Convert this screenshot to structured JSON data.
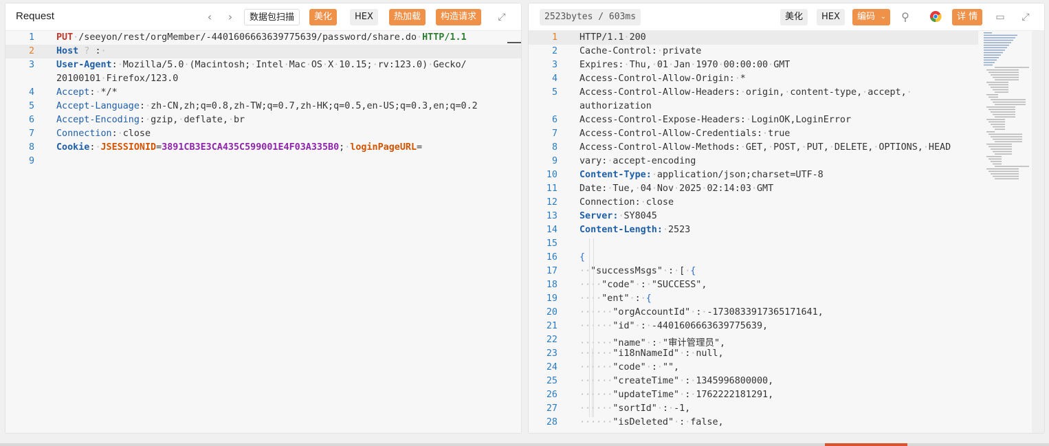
{
  "request": {
    "title": "Request",
    "buttons": {
      "scan": "数据包扫描",
      "beautify": "美化",
      "hex": "HEX",
      "hotload": "热加载",
      "construct": "构造请求"
    },
    "lines": [
      {
        "n": "1",
        "parts": [
          [
            "m",
            "PUT"
          ],
          [
            "d",
            "·"
          ],
          [
            "t",
            "/seeyon/rest/orgMember/-4401606663639775639/password/share.do"
          ],
          [
            "d",
            "·"
          ],
          [
            "v",
            "HTTP/1.1"
          ]
        ]
      },
      {
        "n": "2",
        "parts": [
          [
            "kb",
            "Host"
          ],
          [
            "d",
            " ? "
          ],
          [
            "t",
            ":"
          ],
          [
            "d",
            "·"
          ]
        ]
      },
      {
        "n": "3",
        "parts": [
          [
            "kb",
            "User-Agent"
          ],
          [
            "t",
            ":"
          ],
          [
            "d",
            "·"
          ],
          [
            "t",
            "Mozilla/5.0"
          ],
          [
            "d",
            "·"
          ],
          [
            "t",
            "(Macintosh;"
          ],
          [
            "d",
            "·"
          ],
          [
            "t",
            "Intel"
          ],
          [
            "d",
            "·"
          ],
          [
            "t",
            "Mac"
          ],
          [
            "d",
            "·"
          ],
          [
            "t",
            "OS"
          ],
          [
            "d",
            "·"
          ],
          [
            "t",
            "X"
          ],
          [
            "d",
            "·"
          ],
          [
            "t",
            "10.15;"
          ],
          [
            "d",
            "·"
          ],
          [
            "t",
            "rv:123.0)"
          ],
          [
            "d",
            "·"
          ],
          [
            "t",
            "Gecko/"
          ]
        ]
      },
      {
        "n": "",
        "parts": [
          [
            "t",
            "20100101"
          ],
          [
            "d",
            "·"
          ],
          [
            "t",
            "Firefox/123.0"
          ]
        ]
      },
      {
        "n": "4",
        "parts": [
          [
            "k",
            "Accept"
          ],
          [
            "t",
            ":"
          ],
          [
            "d",
            "·"
          ],
          [
            "t",
            "*/*"
          ]
        ]
      },
      {
        "n": "5",
        "parts": [
          [
            "k",
            "Accept-Language"
          ],
          [
            "t",
            ":"
          ],
          [
            "d",
            "·"
          ],
          [
            "t",
            "zh-CN,zh;q=0.8,zh-TW;q=0.7,zh-HK;q=0.5,en-US;q=0.3,en;q=0.2"
          ]
        ]
      },
      {
        "n": "6",
        "parts": [
          [
            "k",
            "Accept-Encoding"
          ],
          [
            "t",
            ":"
          ],
          [
            "d",
            "·"
          ],
          [
            "t",
            "gzip,"
          ],
          [
            "d",
            "·"
          ],
          [
            "t",
            "deflate,"
          ],
          [
            "d",
            "·"
          ],
          [
            "t",
            "br"
          ]
        ]
      },
      {
        "n": "7",
        "parts": [
          [
            "k",
            "Connection"
          ],
          [
            "t",
            ":"
          ],
          [
            "d",
            "·"
          ],
          [
            "t",
            "close"
          ]
        ]
      },
      {
        "n": "8",
        "parts": [
          [
            "kb",
            "Cookie"
          ],
          [
            "t",
            ":"
          ],
          [
            "d",
            "·"
          ],
          [
            "ck",
            "JSESSIONID"
          ],
          [
            "t",
            "="
          ],
          [
            "cv",
            "3891CB3E3CA435C599001E4F03A335B0"
          ],
          [
            "t",
            ";"
          ],
          [
            "d",
            "·"
          ],
          [
            "ck",
            "loginPageURL"
          ],
          [
            "t",
            "="
          ]
        ]
      },
      {
        "n": "9",
        "parts": []
      }
    ]
  },
  "response": {
    "size": "2523bytes / 603ms",
    "buttons": {
      "beautify": "美化",
      "hex": "HEX",
      "encoding": "编码",
      "details": "详 情"
    },
    "lines": [
      {
        "n": "1",
        "parts": [
          [
            "t",
            "HTTP/1.1"
          ],
          [
            "d",
            "·"
          ],
          [
            "t",
            "200"
          ]
        ]
      },
      {
        "n": "2",
        "parts": [
          [
            "t",
            "Cache-Control:"
          ],
          [
            "d",
            "·"
          ],
          [
            "t",
            "private"
          ]
        ]
      },
      {
        "n": "3",
        "parts": [
          [
            "t",
            "Expires:"
          ],
          [
            "d",
            "·"
          ],
          [
            "t",
            "Thu,"
          ],
          [
            "d",
            "·"
          ],
          [
            "t",
            "01"
          ],
          [
            "d",
            "·"
          ],
          [
            "t",
            "Jan"
          ],
          [
            "d",
            "·"
          ],
          [
            "t",
            "1970"
          ],
          [
            "d",
            "·"
          ],
          [
            "t",
            "00:00:00"
          ],
          [
            "d",
            "·"
          ],
          [
            "t",
            "GMT"
          ]
        ]
      },
      {
        "n": "4",
        "parts": [
          [
            "t",
            "Access-Control-Allow-Origin:"
          ],
          [
            "d",
            "·"
          ],
          [
            "t",
            "*"
          ]
        ]
      },
      {
        "n": "5",
        "parts": [
          [
            "t",
            "Access-Control-Allow-Headers:"
          ],
          [
            "d",
            "·"
          ],
          [
            "t",
            "origin,"
          ],
          [
            "d",
            "·"
          ],
          [
            "t",
            "content-type,"
          ],
          [
            "d",
            "·"
          ],
          [
            "t",
            "accept,"
          ],
          [
            "d",
            "·"
          ]
        ]
      },
      {
        "n": "",
        "parts": [
          [
            "t",
            "authorization"
          ]
        ]
      },
      {
        "n": "6",
        "parts": [
          [
            "t",
            "Access-Control-Expose-Headers:"
          ],
          [
            "d",
            "·"
          ],
          [
            "t",
            "LoginOK,LoginError"
          ]
        ]
      },
      {
        "n": "7",
        "parts": [
          [
            "t",
            "Access-Control-Allow-Credentials:"
          ],
          [
            "d",
            "·"
          ],
          [
            "t",
            "true"
          ]
        ]
      },
      {
        "n": "8",
        "parts": [
          [
            "t",
            "Access-Control-Allow-Methods:"
          ],
          [
            "d",
            "·"
          ],
          [
            "t",
            "GET,"
          ],
          [
            "d",
            "·"
          ],
          [
            "t",
            "POST,"
          ],
          [
            "d",
            "·"
          ],
          [
            "t",
            "PUT,"
          ],
          [
            "d",
            "·"
          ],
          [
            "t",
            "DELETE,"
          ],
          [
            "d",
            "·"
          ],
          [
            "t",
            "OPTIONS,"
          ],
          [
            "d",
            "·"
          ],
          [
            "t",
            "HEAD"
          ]
        ]
      },
      {
        "n": "9",
        "parts": [
          [
            "t",
            "vary:"
          ],
          [
            "d",
            "·"
          ],
          [
            "t",
            "accept-encoding"
          ]
        ]
      },
      {
        "n": "10",
        "parts": [
          [
            "kb",
            "Content-Type:"
          ],
          [
            "d",
            "·"
          ],
          [
            "t",
            "application/json;charset=UTF-8"
          ]
        ]
      },
      {
        "n": "11",
        "parts": [
          [
            "t",
            "Date:"
          ],
          [
            "d",
            "·"
          ],
          [
            "t",
            "Tue,"
          ],
          [
            "d",
            "·"
          ],
          [
            "t",
            "04"
          ],
          [
            "d",
            "·"
          ],
          [
            "t",
            "Nov"
          ],
          [
            "d",
            "·"
          ],
          [
            "t",
            "2025"
          ],
          [
            "d",
            "·"
          ],
          [
            "t",
            "02:14:03"
          ],
          [
            "d",
            "·"
          ],
          [
            "t",
            "GMT"
          ]
        ]
      },
      {
        "n": "12",
        "parts": [
          [
            "t",
            "Connection:"
          ],
          [
            "d",
            "·"
          ],
          [
            "t",
            "close"
          ]
        ]
      },
      {
        "n": "13",
        "parts": [
          [
            "kb",
            "Server:"
          ],
          [
            "d",
            "·"
          ],
          [
            "t",
            "SY8045"
          ]
        ]
      },
      {
        "n": "14",
        "parts": [
          [
            "kb",
            "Content-Length:"
          ],
          [
            "d",
            "·"
          ],
          [
            "t",
            "2523"
          ]
        ]
      },
      {
        "n": "15",
        "parts": []
      },
      {
        "n": "16",
        "parts": [
          [
            "bt",
            "{"
          ]
        ]
      },
      {
        "n": "17",
        "parts": [
          [
            "d",
            "··"
          ],
          [
            "t",
            "\"successMsgs\""
          ],
          [
            "d",
            "·"
          ],
          [
            "t",
            ":"
          ],
          [
            "d",
            "·"
          ],
          [
            "t",
            "["
          ],
          [
            "d",
            "·"
          ],
          [
            "bt",
            "{"
          ]
        ]
      },
      {
        "n": "18",
        "parts": [
          [
            "d",
            "····"
          ],
          [
            "t",
            "\"code\""
          ],
          [
            "d",
            "·"
          ],
          [
            "t",
            ":"
          ],
          [
            "d",
            "·"
          ],
          [
            "t",
            "\"SUCCESS\","
          ]
        ]
      },
      {
        "n": "19",
        "parts": [
          [
            "d",
            "····"
          ],
          [
            "t",
            "\"ent\""
          ],
          [
            "d",
            "·"
          ],
          [
            "t",
            ":"
          ],
          [
            "d",
            "·"
          ],
          [
            "bt",
            "{"
          ]
        ]
      },
      {
        "n": "20",
        "parts": [
          [
            "d",
            "······"
          ],
          [
            "t",
            "\"orgAccountId\""
          ],
          [
            "d",
            "·"
          ],
          [
            "t",
            ":"
          ],
          [
            "d",
            "·"
          ],
          [
            "t",
            "-1730833917365171641,"
          ]
        ]
      },
      {
        "n": "21",
        "parts": [
          [
            "d",
            "······"
          ],
          [
            "t",
            "\"id\""
          ],
          [
            "d",
            "·"
          ],
          [
            "t",
            ":"
          ],
          [
            "d",
            "·"
          ],
          [
            "t",
            "-4401606663639775639,"
          ]
        ]
      },
      {
        "n": "22",
        "parts": [
          [
            "d",
            "······"
          ],
          [
            "t",
            "\"name\""
          ],
          [
            "d",
            "·"
          ],
          [
            "t",
            ":"
          ],
          [
            "d",
            "·"
          ],
          [
            "t",
            "\"审计管理员\","
          ]
        ]
      },
      {
        "n": "23",
        "parts": [
          [
            "d",
            "······"
          ],
          [
            "t",
            "\"i18nNameId\""
          ],
          [
            "d",
            "·"
          ],
          [
            "t",
            ":"
          ],
          [
            "d",
            "·"
          ],
          [
            "t",
            "null,"
          ]
        ]
      },
      {
        "n": "24",
        "parts": [
          [
            "d",
            "······"
          ],
          [
            "t",
            "\"code\""
          ],
          [
            "d",
            "·"
          ],
          [
            "t",
            ":"
          ],
          [
            "d",
            "·"
          ],
          [
            "t",
            "\"\","
          ]
        ]
      },
      {
        "n": "25",
        "parts": [
          [
            "d",
            "······"
          ],
          [
            "t",
            "\"createTime\""
          ],
          [
            "d",
            "·"
          ],
          [
            "t",
            ":"
          ],
          [
            "d",
            "·"
          ],
          [
            "t",
            "1345996800000,"
          ]
        ]
      },
      {
        "n": "26",
        "parts": [
          [
            "d",
            "······"
          ],
          [
            "t",
            "\"updateTime\""
          ],
          [
            "d",
            "·"
          ],
          [
            "t",
            ":"
          ],
          [
            "d",
            "·"
          ],
          [
            "t",
            "1762222181291,"
          ]
        ]
      },
      {
        "n": "27",
        "parts": [
          [
            "d",
            "······"
          ],
          [
            "t",
            "\"sortId\""
          ],
          [
            "d",
            "·"
          ],
          [
            "t",
            ":"
          ],
          [
            "d",
            "·"
          ],
          [
            "t",
            "-1,"
          ]
        ]
      },
      {
        "n": "28",
        "parts": [
          [
            "d",
            "······"
          ],
          [
            "t",
            "\"isDeleted\""
          ],
          [
            "d",
            "·"
          ],
          [
            "t",
            ":"
          ],
          [
            "d",
            "·"
          ],
          [
            "t",
            "false,"
          ]
        ]
      }
    ]
  },
  "colors": {
    "accent": "#f0914a",
    "keyword": "#1f5fa8",
    "method": "#c0392b",
    "version": "#2e7d32"
  }
}
